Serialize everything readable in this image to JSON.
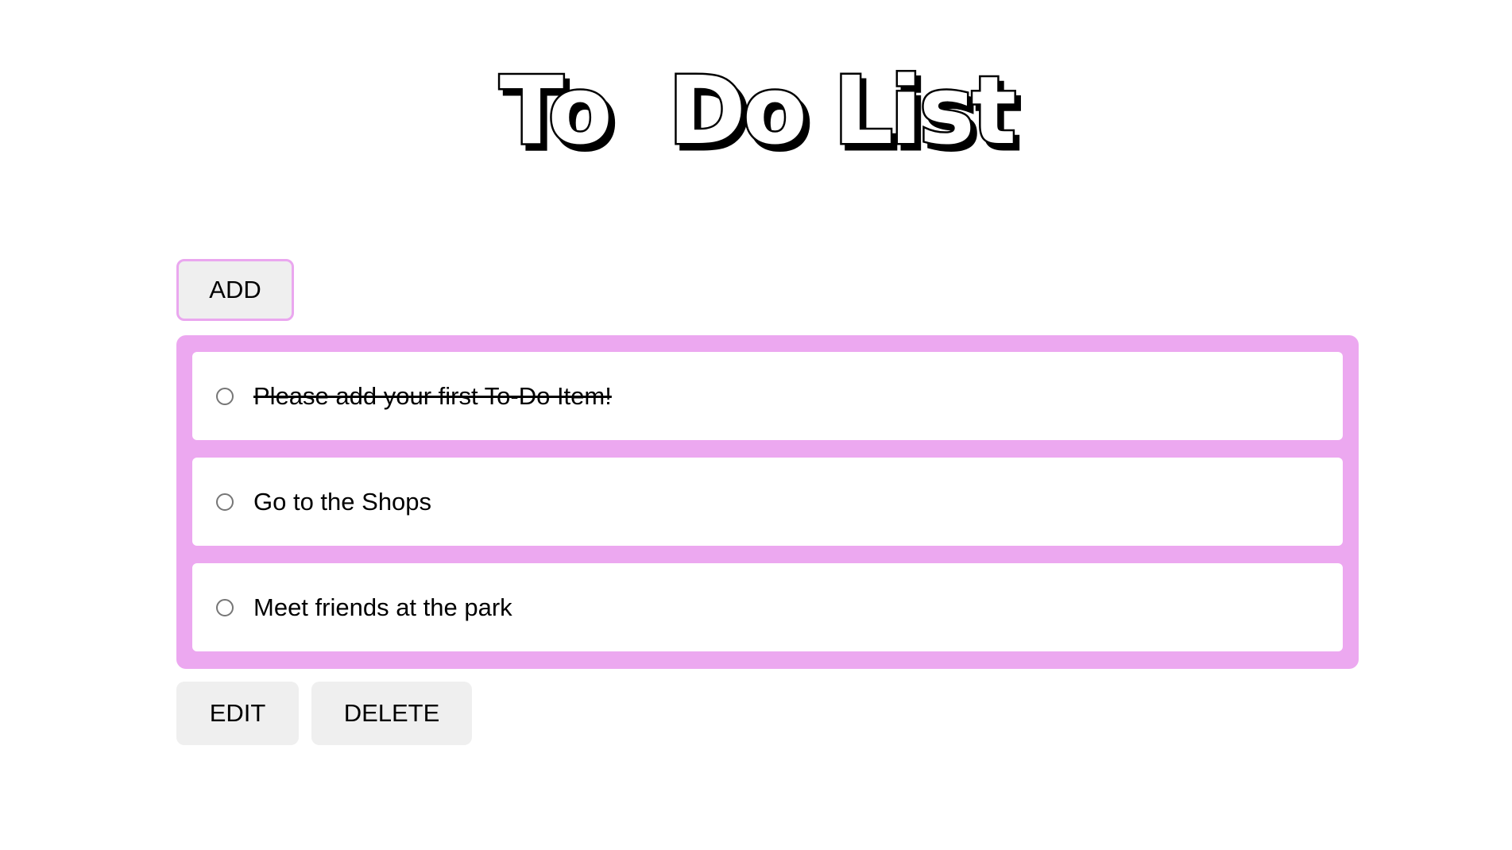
{
  "header": {
    "title": "To  Do List"
  },
  "toolbar": {
    "add_label": "ADD",
    "edit_label": "EDIT",
    "delete_label": "DELETE"
  },
  "todo": {
    "items": [
      {
        "label": "Please add your first To-Do Item!",
        "completed": true,
        "selected": false
      },
      {
        "label": "Go to the Shops",
        "completed": false,
        "selected": false
      },
      {
        "label": "Meet friends at the park",
        "completed": false,
        "selected": false
      }
    ]
  },
  "colors": {
    "accent": "#eca8f0",
    "button_bg": "#efefef",
    "item_bg": "#ffffff"
  }
}
